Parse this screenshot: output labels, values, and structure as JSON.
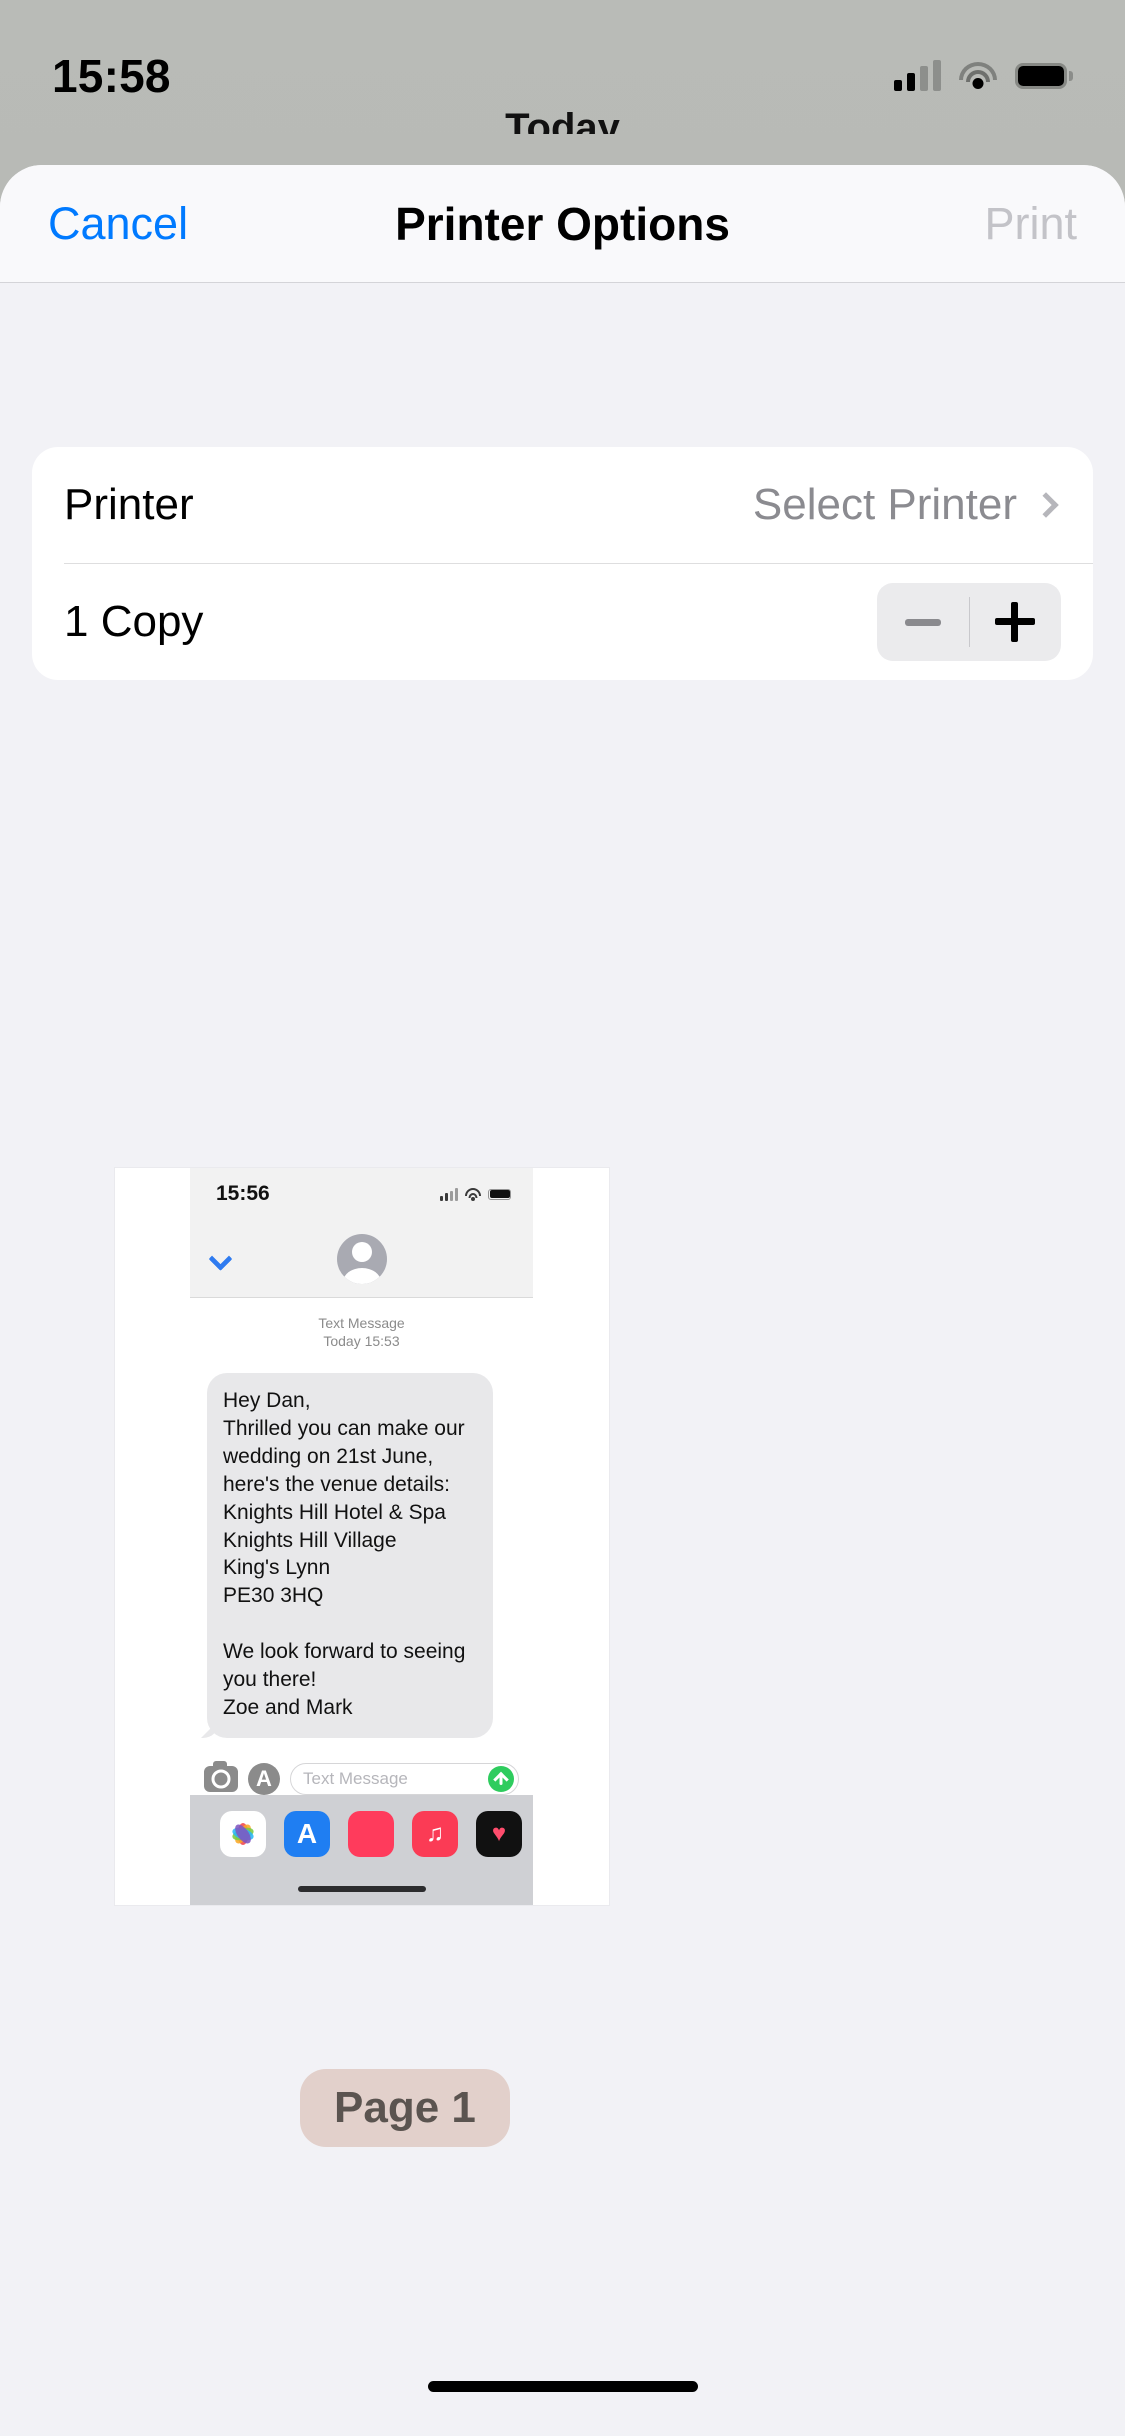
{
  "status_bar": {
    "time": "15:58",
    "cellular_icon": "cellular-signal-icon",
    "wifi_icon": "wifi-icon",
    "battery_icon": "battery-icon"
  },
  "host_peek_title": "Today",
  "navbar": {
    "cancel_label": "Cancel",
    "title": "Printer Options",
    "print_label": "Print",
    "print_enabled": false,
    "cancel_color": "#007AFF",
    "print_color": "#C3C3C8"
  },
  "options": {
    "printer_row": {
      "label": "Printer",
      "value": "Select Printer",
      "chevron": "chevron-right-icon"
    },
    "copies_row": {
      "label": "1 Copy",
      "decrement_label": "−",
      "increment_label": "+",
      "decrement_enabled": false,
      "increment_enabled": true
    }
  },
  "preview": {
    "page_badge": "Page 1",
    "status_bar": {
      "time": "15:56"
    },
    "conversation_header": {
      "back_icon": "chevron-left-icon",
      "avatar_icon": "contact-avatar-icon"
    },
    "stamp_line1": "Text Message",
    "stamp_line2": "Today 15:53",
    "message_body": "Hey Dan,\nThrilled you can make our wedding on 21st June, here's the venue details:\nKnights Hill Hotel & Spa\nKnights Hill Village\nKing's Lynn\nPE30 3HQ\n\nWe look forward to seeing you there!\nZoe and Mark",
    "toolbar": {
      "camera_icon": "camera-icon",
      "appstore_icon": "app-store-icon",
      "input_placeholder": "Text Message",
      "send_icon": "send-arrow-icon"
    },
    "app_drawer": [
      {
        "name": "photos-app-icon",
        "label": ""
      },
      {
        "name": "app-store-app-icon",
        "label": ""
      },
      {
        "name": "pink-app-icon",
        "label": ""
      },
      {
        "name": "music-app-icon",
        "label": "♫"
      },
      {
        "name": "health-app-icon",
        "label": "♥"
      }
    ]
  }
}
